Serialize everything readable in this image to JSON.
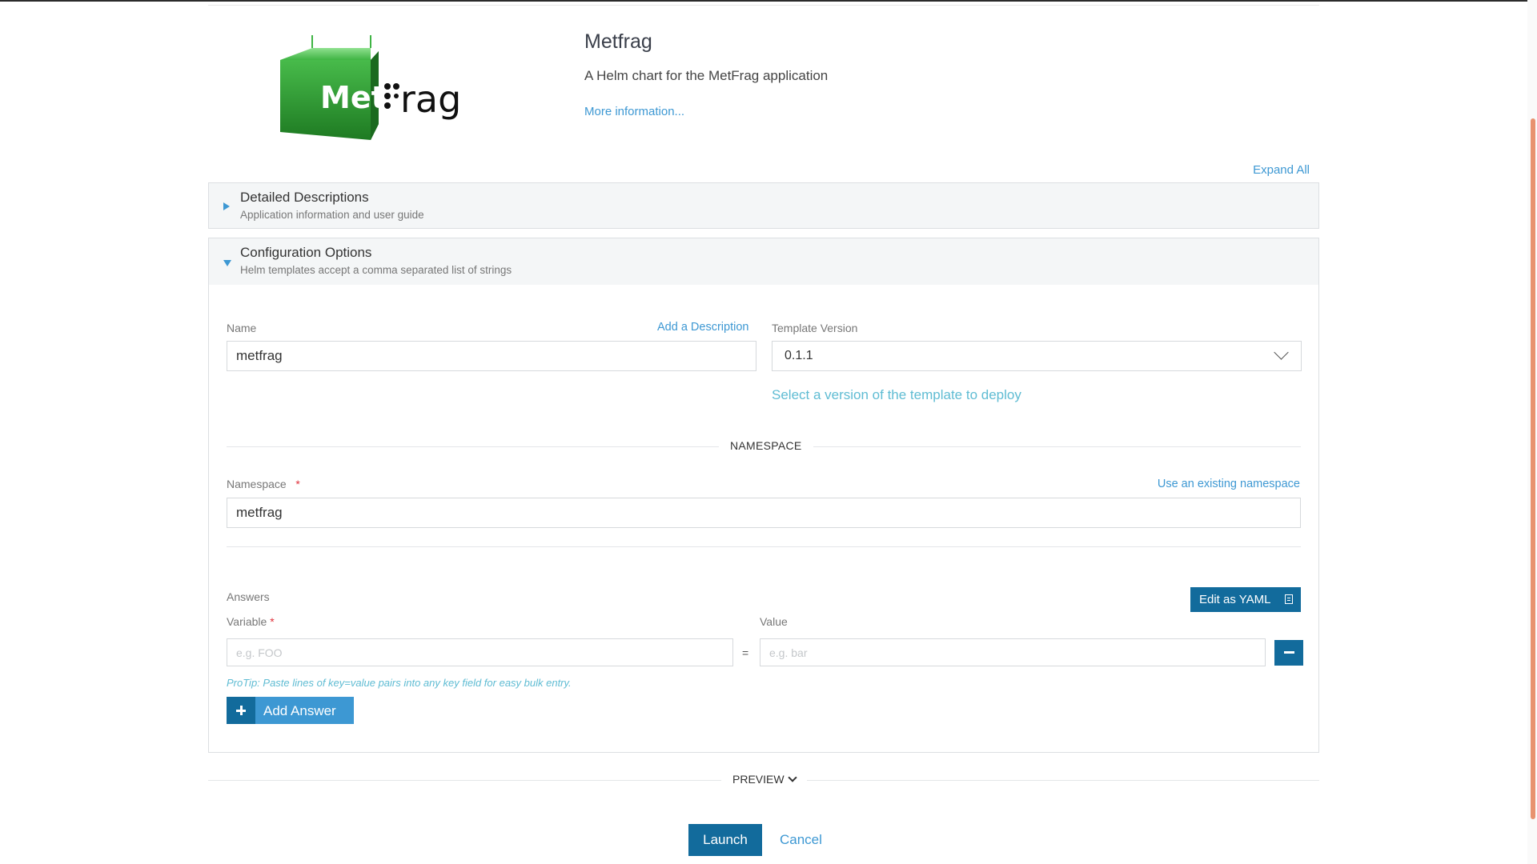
{
  "app": {
    "title": "Metfrag",
    "description": "A Helm chart for the MetFrag application",
    "more_info": "More information...",
    "logo_text": {
      "met": "Met",
      "frag": "Frag"
    }
  },
  "expand_all": "Expand All",
  "sections": [
    {
      "title": "Detailed Descriptions",
      "subtitle": "Application information and user guide",
      "expanded": false
    },
    {
      "title": "Configuration Options",
      "subtitle": "Helm templates accept a comma separated list of strings",
      "expanded": true
    }
  ],
  "form": {
    "name_label": "Name",
    "add_description": "Add a Description",
    "name_value": "metfrag",
    "template_version_label": "Template Version",
    "template_version_value": "0.1.1",
    "template_version_help": "Select a version of the template to deploy",
    "namespace_section": "NAMESPACE",
    "namespace_label": "Namespace",
    "required_mark": "*",
    "use_existing_namespace": "Use an existing namespace",
    "namespace_value": "metfrag",
    "answers_label": "Answers",
    "edit_yaml": "Edit as YAML",
    "variable_label": "Variable",
    "value_label": "Value",
    "variable_placeholder": "e.g. FOO",
    "value_placeholder": "e.g. bar",
    "equals": "=",
    "protip": "ProTip: Paste lines of key=value pairs into any key field for easy bulk entry.",
    "add_answer": "Add Answer"
  },
  "preview_label": "PREVIEW",
  "actions": {
    "launch": "Launch",
    "cancel": "Cancel"
  },
  "colors": {
    "accent": "#3d98d3",
    "primary_dark": "#126b9c",
    "help_text": "#5fbcd3",
    "logo_green": "#2fa334",
    "required": "#e0303a",
    "scrollbar": "#e8926f"
  },
  "icons": [
    "caret-right-icon",
    "caret-down-icon",
    "chevron-down-icon",
    "clipboard-icon",
    "minus-icon",
    "plus-icon"
  ]
}
